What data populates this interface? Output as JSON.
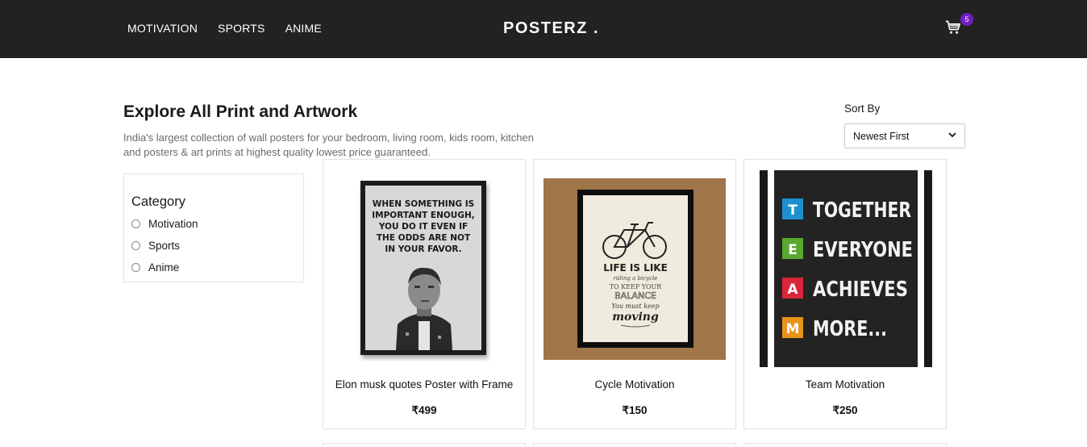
{
  "nav": {
    "links": [
      "MOTIVATION",
      "SPORTS",
      "ANIME"
    ],
    "logo": "POSTERZ .",
    "cart_count": "5"
  },
  "header": {
    "title": "Explore All Print and Artwork",
    "description": "India's largest collection of wall posters for your bedroom, living room, kids room, kitchen and posters & art prints at highest quality lowest price guaranteed."
  },
  "sort": {
    "label": "Sort By",
    "selected": "Newest First"
  },
  "filter": {
    "title": "Category",
    "options": [
      "Motivation",
      "Sports",
      "Anime"
    ]
  },
  "products": [
    {
      "name": "Elon musk quotes Poster with Frame",
      "price": "₹499",
      "poster_lines": [
        "WHEN SOMETHING IS",
        "IMPORTANT ENOUGH,",
        "YOU DO IT EVEN IF",
        "THE ODDS ARE NOT",
        "IN YOUR FAVOR."
      ]
    },
    {
      "name": "Cycle Motivation",
      "price": "₹150",
      "poster_lines": [
        "LIFE IS LIKE",
        "riding a bicycle",
        "TO KEEP YOUR",
        "BALANCE",
        "You must keep",
        "moving"
      ]
    },
    {
      "name": "Team Motivation",
      "price": "₹250",
      "poster_lines": [
        "T",
        "TOGETHER",
        "E",
        "EVERYONE",
        "A",
        "ACHIEVES",
        "M",
        "MORE..."
      ]
    }
  ],
  "colors": {
    "navbar": "#222222",
    "badge": "#6f1fc4",
    "team_t": "#1d8fcf",
    "team_e": "#5aa832",
    "team_a": "#d9263a",
    "team_m": "#e8931a"
  }
}
